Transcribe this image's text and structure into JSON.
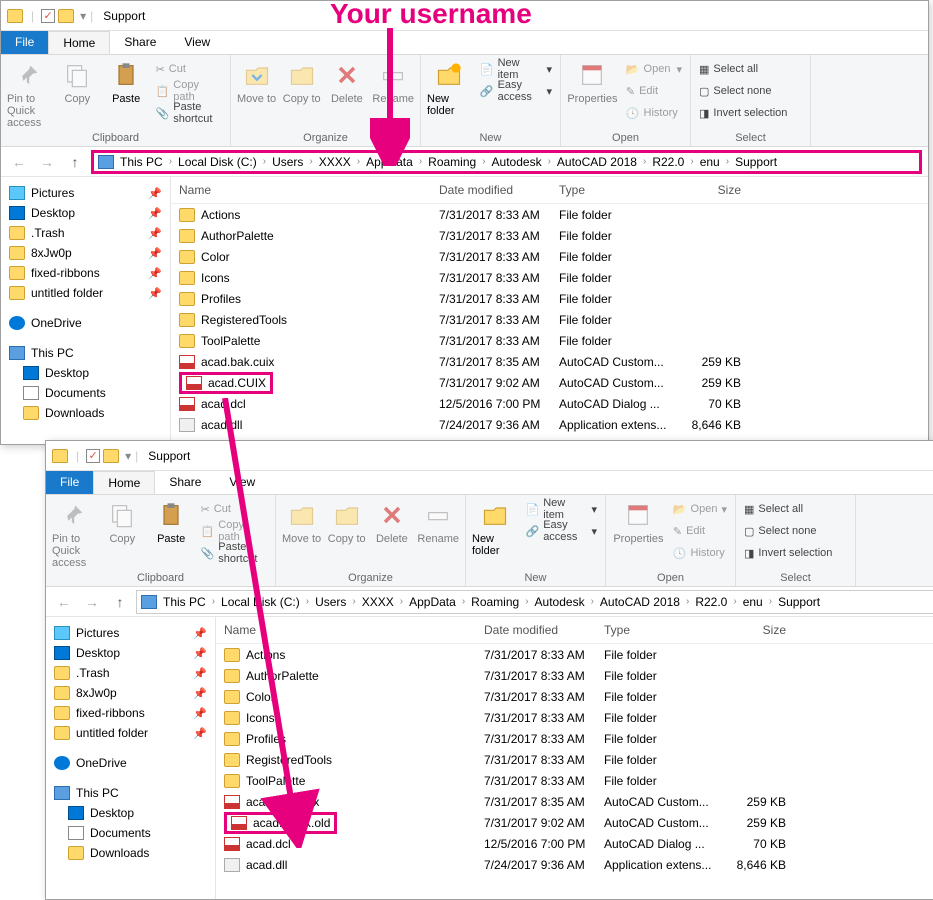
{
  "callout": "Your username",
  "window": {
    "title": "Support",
    "tabs": {
      "file": "File",
      "home": "Home",
      "share": "Share",
      "view": "View"
    },
    "ribbon": {
      "clipboard": {
        "label": "Clipboard",
        "pin": "Pin to Quick access",
        "copy": "Copy",
        "paste": "Paste",
        "cut": "Cut",
        "copypath": "Copy path",
        "pasteshortcut": "Paste shortcut"
      },
      "organize": {
        "label": "Organize",
        "moveto": "Move to",
        "copyto": "Copy to",
        "delete": "Delete",
        "rename": "Rename"
      },
      "new": {
        "label": "New",
        "newfolder": "New folder",
        "newitem": "New item",
        "easyaccess": "Easy access"
      },
      "open": {
        "label": "Open",
        "properties": "Properties",
        "open": "Open",
        "edit": "Edit",
        "history": "History"
      },
      "select": {
        "label": "Select",
        "selectall": "Select all",
        "selectnone": "Select none",
        "invert": "Invert selection"
      }
    },
    "breadcrumbs": [
      "This PC",
      "Local Disk (C:)",
      "Users",
      "XXXX",
      "AppData",
      "Roaming",
      "Autodesk",
      "AutoCAD 2018",
      "R22.0",
      "enu",
      "Support"
    ],
    "nav": {
      "quick": [
        "Pictures",
        "Desktop",
        ".Trash",
        "8xJw0p",
        "fixed-ribbons",
        "untitled folder"
      ],
      "onedrive": "OneDrive",
      "thispc": "This PC",
      "thispc_items": [
        "Desktop",
        "Documents",
        "Downloads"
      ]
    },
    "columns": {
      "name": "Name",
      "date": "Date modified",
      "type": "Type",
      "size": "Size"
    }
  },
  "files1": [
    {
      "name": "Actions",
      "date": "7/31/2017 8:33 AM",
      "type": "File folder",
      "size": "",
      "icon": "folder"
    },
    {
      "name": "AuthorPalette",
      "date": "7/31/2017 8:33 AM",
      "type": "File folder",
      "size": "",
      "icon": "folder"
    },
    {
      "name": "Color",
      "date": "7/31/2017 8:33 AM",
      "type": "File folder",
      "size": "",
      "icon": "folder"
    },
    {
      "name": "Icons",
      "date": "7/31/2017 8:33 AM",
      "type": "File folder",
      "size": "",
      "icon": "folder"
    },
    {
      "name": "Profiles",
      "date": "7/31/2017 8:33 AM",
      "type": "File folder",
      "size": "",
      "icon": "folder"
    },
    {
      "name": "RegisteredTools",
      "date": "7/31/2017 8:33 AM",
      "type": "File folder",
      "size": "",
      "icon": "folder"
    },
    {
      "name": "ToolPalette",
      "date": "7/31/2017 8:33 AM",
      "type": "File folder",
      "size": "",
      "icon": "folder"
    },
    {
      "name": "acad.bak.cuix",
      "date": "7/31/2017 8:35 AM",
      "type": "AutoCAD Custom...",
      "size": "259 KB",
      "icon": "cuix"
    },
    {
      "name": "acad.CUIX",
      "date": "7/31/2017 9:02 AM",
      "type": "AutoCAD Custom...",
      "size": "259 KB",
      "icon": "cuix",
      "highlight": true
    },
    {
      "name": "acad.dcl",
      "date": "12/5/2016 7:00 PM",
      "type": "AutoCAD Dialog ...",
      "size": "70 KB",
      "icon": "dcl"
    },
    {
      "name": "acad.dll",
      "date": "7/24/2017 9:36 AM",
      "type": "Application extens...",
      "size": "8,646 KB",
      "icon": "dll"
    }
  ],
  "files2": [
    {
      "name": "Actions",
      "date": "7/31/2017 8:33 AM",
      "type": "File folder",
      "size": "",
      "icon": "folder"
    },
    {
      "name": "AuthorPalette",
      "date": "7/31/2017 8:33 AM",
      "type": "File folder",
      "size": "",
      "icon": "folder"
    },
    {
      "name": "Color",
      "date": "7/31/2017 8:33 AM",
      "type": "File folder",
      "size": "",
      "icon": "folder"
    },
    {
      "name": "Icons",
      "date": "7/31/2017 8:33 AM",
      "type": "File folder",
      "size": "",
      "icon": "folder"
    },
    {
      "name": "Profiles",
      "date": "7/31/2017 8:33 AM",
      "type": "File folder",
      "size": "",
      "icon": "folder"
    },
    {
      "name": "RegisteredTools",
      "date": "7/31/2017 8:33 AM",
      "type": "File folder",
      "size": "",
      "icon": "folder"
    },
    {
      "name": "ToolPalette",
      "date": "7/31/2017 8:33 AM",
      "type": "File folder",
      "size": "",
      "icon": "folder"
    },
    {
      "name": "acad.bak.cuix",
      "date": "7/31/2017 8:35 AM",
      "type": "AutoCAD Custom...",
      "size": "259 KB",
      "icon": "cuix"
    },
    {
      "name": "acad.CUIX.old",
      "date": "7/31/2017 9:02 AM",
      "type": "AutoCAD Custom...",
      "size": "259 KB",
      "icon": "cuix",
      "highlight": true
    },
    {
      "name": "acad.dcl",
      "date": "12/5/2016 7:00 PM",
      "type": "AutoCAD Dialog ...",
      "size": "70 KB",
      "icon": "dcl"
    },
    {
      "name": "acad.dll",
      "date": "7/24/2017 9:36 AM",
      "type": "Application extens...",
      "size": "8,646 KB",
      "icon": "dll"
    }
  ]
}
